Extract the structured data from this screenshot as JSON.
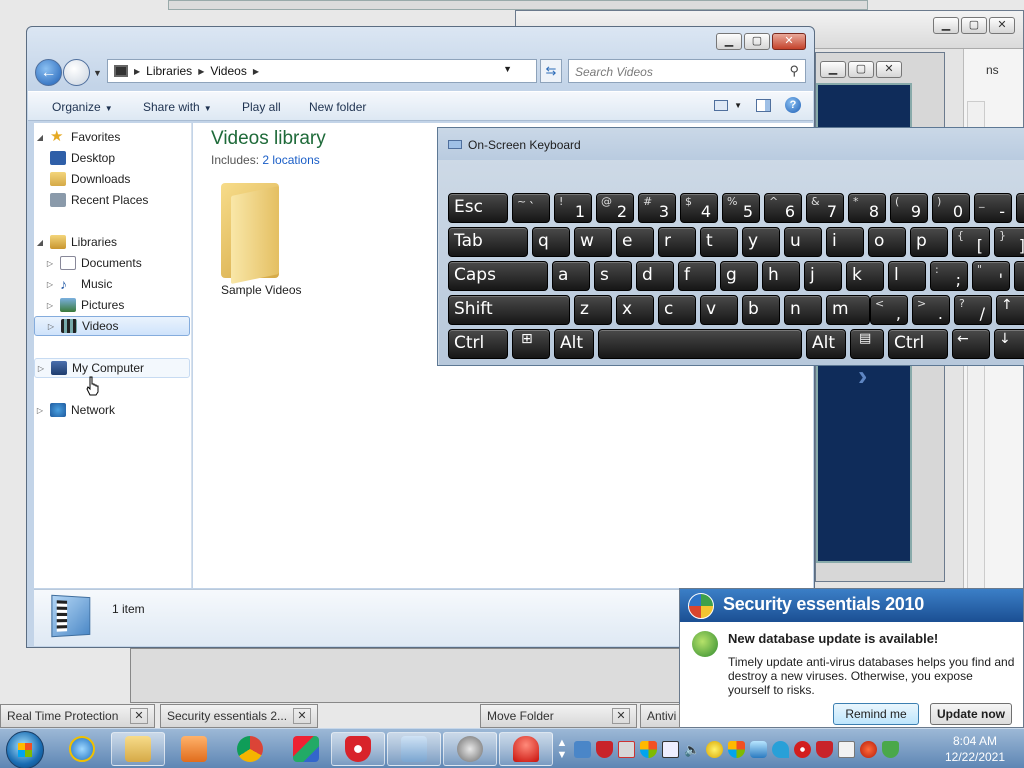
{
  "background_windows": {
    "move_folder_title": "Move Folder",
    "antivirus_title": "Antivi",
    "realtime_title": "Real Time Protection",
    "security_strip_title": "Security essentials 2...",
    "right_partial_text": "ns"
  },
  "explorer": {
    "breadcrumb": [
      "Libraries",
      "Videos"
    ],
    "search_placeholder": "Search Videos",
    "toolbar": {
      "organize": "Organize",
      "share_with": "Share with",
      "play_all": "Play all",
      "new_folder": "New folder"
    },
    "nav": {
      "favorites": "Favorites",
      "desktop": "Desktop",
      "downloads": "Downloads",
      "recent_places": "Recent Places",
      "libraries": "Libraries",
      "documents": "Documents",
      "music": "Music",
      "pictures": "Pictures",
      "videos": "Videos",
      "my_computer": "My Computer",
      "network": "Network"
    },
    "library_title": "Videos library",
    "includes_label": "Includes:",
    "includes_link": "2 locations",
    "items": [
      {
        "name": "Sample Videos"
      }
    ],
    "status_count": "1 item"
  },
  "osk": {
    "title": "On-Screen Keyboard",
    "row1": [
      {
        "main": "Esc"
      },
      {
        "shift": "~",
        "base": "`"
      },
      {
        "shift": "!",
        "base": "1"
      },
      {
        "shift": "@",
        "base": "2"
      },
      {
        "shift": "#",
        "base": "3"
      },
      {
        "shift": "$",
        "base": "4"
      },
      {
        "shift": "%",
        "base": "5"
      },
      {
        "shift": "^",
        "base": "6"
      },
      {
        "shift": "&",
        "base": "7"
      },
      {
        "shift": "*",
        "base": "8"
      },
      {
        "shift": "(",
        "base": "9"
      },
      {
        "shift": ")",
        "base": "0"
      },
      {
        "shift": "_",
        "base": "-"
      }
    ],
    "row2": [
      "Tab",
      "q",
      "w",
      "e",
      "r",
      "t",
      "y",
      "u",
      "i",
      "o",
      "p",
      {
        "shift": "{",
        "base": "["
      },
      {
        "shift": "}",
        "base": "]"
      }
    ],
    "row3": [
      "Caps",
      "a",
      "s",
      "d",
      "f",
      "g",
      "h",
      "j",
      "k",
      "l",
      {
        "shift": ":",
        "base": ";"
      },
      {
        "shift": "\"",
        "base": "'"
      }
    ],
    "row4": [
      "Shift",
      "z",
      "x",
      "c",
      "v",
      "b",
      "n",
      "m",
      {
        "shift": "<",
        "base": ","
      },
      {
        "shift": ">",
        "base": "."
      },
      {
        "shift": "?",
        "base": "/"
      },
      "↑"
    ],
    "row5": [
      "Ctrl",
      "⊞",
      "Alt",
      "",
      "Alt",
      "▤",
      "Ctrl",
      "←",
      "↓"
    ]
  },
  "security_popup": {
    "title": "Security essentials 2010",
    "heading": "New database update is available!",
    "body": "Timely update anti-virus databases helps you find and destroy a new viruses. Otherwise, you expose yourself to risks.",
    "remind_button": "Remind me later",
    "update_button": "Update now"
  },
  "clock": {
    "time": "8:04 AM",
    "date": "12/22/2021"
  }
}
